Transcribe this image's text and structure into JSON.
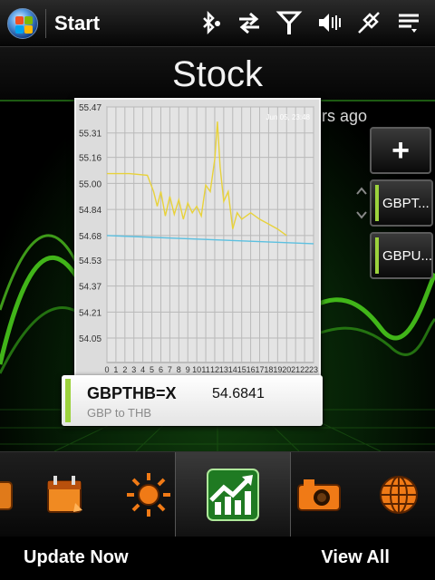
{
  "statusbar": {
    "title": "Start",
    "icons": [
      "windows-start-icon",
      "bluetooth-icon",
      "data-sync-icon",
      "signal-strength-icon",
      "volume-icon",
      "battery-charging-icon",
      "menu-icon"
    ]
  },
  "header": {
    "title": "Stock"
  },
  "updated": "14 hours ago",
  "chart_data": {
    "type": "line",
    "title": "",
    "timestamp": "Jun 05, 23:48",
    "y_ticks": [
      "55.47",
      "55.31",
      "55.16",
      "55.00",
      "54.84",
      "54.68",
      "54.53",
      "54.37",
      "54.21",
      "54.05"
    ],
    "x_ticks": [
      "0",
      "1",
      "2",
      "3",
      "4",
      "5",
      "6",
      "7",
      "8",
      "9",
      "10",
      "11",
      "12",
      "13",
      "14",
      "15",
      "16",
      "17",
      "18",
      "19",
      "20",
      "21",
      "22",
      "23"
    ],
    "ylim": [
      53.9,
      55.47
    ],
    "xlim": [
      0,
      23
    ],
    "series": [
      {
        "color": "#e8d23a",
        "x": [
          0,
          2.5,
          4.5,
          5.2,
          5.6,
          6.0,
          6.5,
          7.0,
          7.5,
          8.0,
          8.5,
          9.0,
          9.5,
          10.0,
          10.5,
          11.0,
          11.5,
          12.0,
          12.3,
          12.6,
          13.0,
          13.5,
          14.0,
          14.5,
          15.0,
          16.0,
          17.0,
          18.0,
          19.0,
          20.0
        ],
        "values": [
          55.06,
          55.06,
          55.05,
          54.95,
          54.86,
          54.95,
          54.8,
          54.92,
          54.81,
          54.9,
          54.78,
          54.88,
          54.82,
          54.86,
          54.8,
          54.99,
          54.95,
          55.15,
          55.38,
          55.1,
          54.89,
          54.95,
          54.72,
          54.82,
          54.78,
          54.82,
          54.78,
          54.75,
          54.72,
          54.68
        ]
      },
      {
        "color": "#5cc0e0",
        "x": [
          0,
          23
        ],
        "values": [
          54.68,
          54.63
        ]
      }
    ]
  },
  "quote": {
    "symbol": "GBPTHB=X",
    "price": "54.6841",
    "description": "GBP to THB"
  },
  "side": {
    "add_label": "+",
    "items": [
      {
        "label": "GBPT...",
        "selected": true
      },
      {
        "label": "GBPU..."
      }
    ]
  },
  "iconbar": {
    "items": [
      "calendar-icon",
      "weather-icon",
      "stocks-icon",
      "camera-icon",
      "internet-icon"
    ],
    "active": "stocks-icon"
  },
  "softkeys": {
    "left": "Update Now",
    "right": "View All"
  },
  "colors": {
    "accent": "#6fcf1f",
    "brand_green": "#2e9a22",
    "chart_line": "#e8d23a"
  }
}
